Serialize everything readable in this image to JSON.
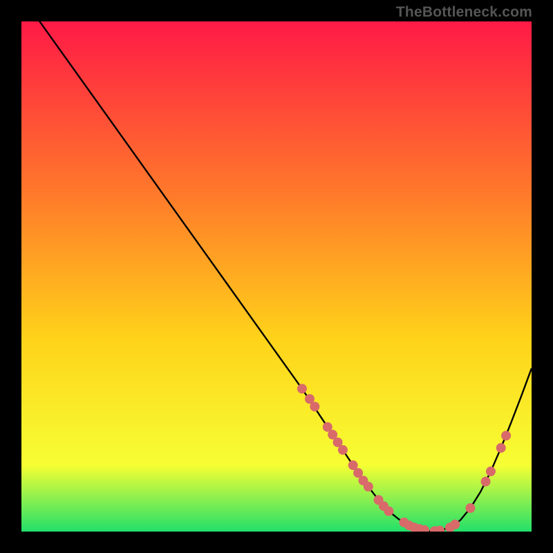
{
  "watermark": "TheBottleneck.com",
  "colors": {
    "gradient_top": "#ff1a46",
    "gradient_mid1": "#ff7a2a",
    "gradient_mid2": "#ffd21a",
    "gradient_mid3": "#f6ff33",
    "gradient_bottom": "#22e06a",
    "curve": "#000000",
    "marker": "#d86a6a",
    "background": "#000000"
  },
  "chart_data": {
    "type": "line",
    "title": "",
    "xlabel": "",
    "ylabel": "",
    "xlim": [
      0,
      100
    ],
    "ylim": [
      0,
      100
    ],
    "series": [
      {
        "name": "bottleneck-curve",
        "x": [
          0,
          5,
          10,
          15,
          20,
          25,
          30,
          35,
          40,
          45,
          50,
          55,
          60,
          62,
          64,
          66,
          68,
          70,
          72,
          74,
          76,
          78,
          80,
          82,
          84,
          86,
          88,
          90,
          92,
          94,
          96,
          98,
          100
        ],
        "y": [
          105,
          98,
          91,
          84,
          77,
          70,
          63,
          56,
          49,
          42,
          35,
          28,
          20.5,
          17.5,
          14.5,
          11.5,
          8.8,
          6.2,
          4.0,
          2.4,
          1.2,
          0.5,
          0.1,
          0.2,
          0.8,
          2.2,
          4.6,
          7.8,
          11.8,
          16.4,
          21.4,
          26.6,
          32.0
        ]
      }
    ],
    "markers": [
      {
        "x": 55,
        "y": 28
      },
      {
        "x": 56.5,
        "y": 26
      },
      {
        "x": 57.5,
        "y": 24.5
      },
      {
        "x": 60,
        "y": 20.5
      },
      {
        "x": 61,
        "y": 19
      },
      {
        "x": 62,
        "y": 17.5
      },
      {
        "x": 63,
        "y": 16
      },
      {
        "x": 65,
        "y": 13
      },
      {
        "x": 66,
        "y": 11.5
      },
      {
        "x": 67,
        "y": 10
      },
      {
        "x": 68,
        "y": 8.8
      },
      {
        "x": 70,
        "y": 6.2
      },
      {
        "x": 71,
        "y": 5
      },
      {
        "x": 72,
        "y": 4
      },
      {
        "x": 75,
        "y": 1.8
      },
      {
        "x": 76,
        "y": 1.2
      },
      {
        "x": 77,
        "y": 0.8
      },
      {
        "x": 78,
        "y": 0.5
      },
      {
        "x": 79,
        "y": 0.3
      },
      {
        "x": 81,
        "y": 0.1
      },
      {
        "x": 82,
        "y": 0.2
      },
      {
        "x": 84,
        "y": 0.8
      },
      {
        "x": 85,
        "y": 1.4
      },
      {
        "x": 88,
        "y": 4.6
      },
      {
        "x": 91,
        "y": 9.8
      },
      {
        "x": 92,
        "y": 11.8
      },
      {
        "x": 94,
        "y": 16.4
      },
      {
        "x": 95,
        "y": 18.8
      }
    ]
  }
}
